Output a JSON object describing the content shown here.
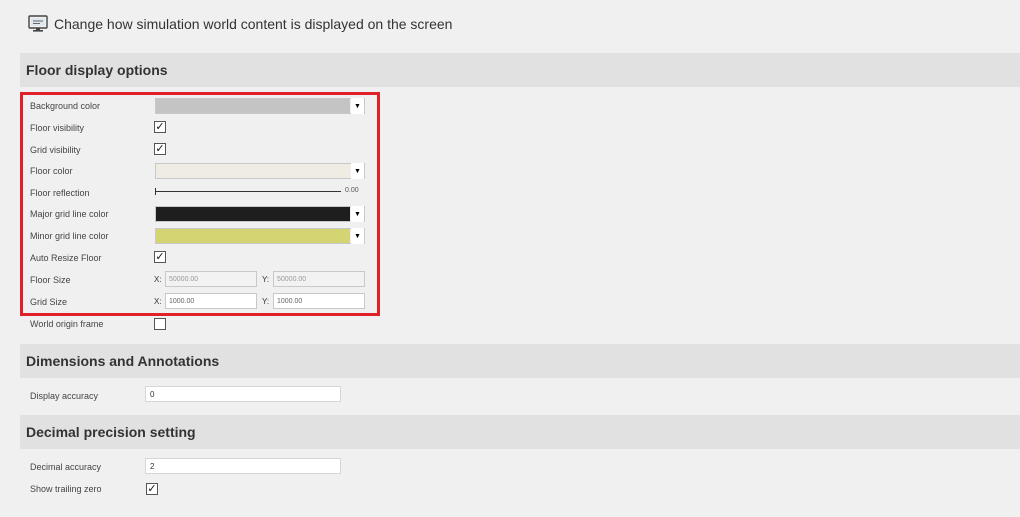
{
  "header": {
    "text": "Change how simulation world content is displayed on the screen",
    "icon": "monitor-icon"
  },
  "sections": {
    "floor": {
      "title": "Floor display options",
      "background_color": {
        "label": "Background color",
        "value": "#c4c4c4"
      },
      "floor_visibility": {
        "label": "Floor visibility",
        "checked": true
      },
      "grid_visibility": {
        "label": "Grid visibility",
        "checked": true
      },
      "floor_color": {
        "label": "Floor color",
        "value": "#efece4"
      },
      "floor_reflection": {
        "label": "Floor reflection",
        "value": "0.00"
      },
      "major_grid_color": {
        "label": "Major grid line color",
        "value": "#1e1e1e"
      },
      "minor_grid_color": {
        "label": "Minor grid line color",
        "value": "#d4d472"
      },
      "auto_resize": {
        "label": "Auto Resize Floor",
        "checked": true
      },
      "floor_size": {
        "label": "Floor Size",
        "x_label": "X:",
        "x": "50000.00",
        "y_label": "Y:",
        "y": "50000.00"
      },
      "grid_size": {
        "label": "Grid Size",
        "x_label": "X:",
        "x": "1000.00",
        "y_label": "Y:",
        "y": "1000.00"
      },
      "world_origin": {
        "label": "World origin frame",
        "checked": false
      }
    },
    "dimensions": {
      "title": "Dimensions and Annotations",
      "display_accuracy": {
        "label": "Display accuracy",
        "value": "0"
      }
    },
    "decimal": {
      "title": "Decimal precision setting",
      "decimal_accuracy": {
        "label": "Decimal accuracy",
        "value": "2"
      },
      "trailing_zero": {
        "label": "Show trailing zero",
        "checked": true
      }
    }
  },
  "glyphs": {
    "check": "✓",
    "dropdown": "▼"
  },
  "colors": {
    "highlight": "#e0202a",
    "section_bg": "#e1e1e1",
    "page_bg": "#f0f0f0"
  }
}
